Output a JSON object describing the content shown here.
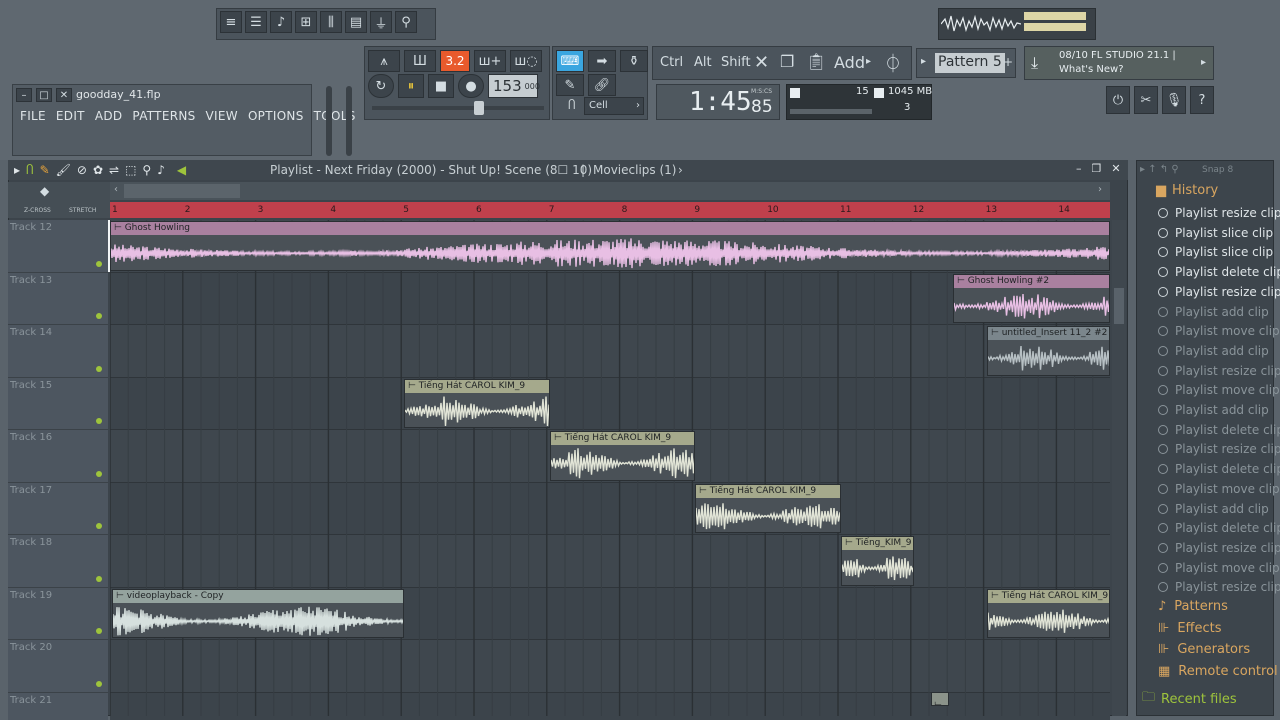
{
  "file": {
    "name": "goodday_41.flp"
  },
  "menu": [
    "FILE",
    "EDIT",
    "ADD",
    "PATTERNS",
    "VIEW",
    "OPTIONS",
    "TOOLS",
    "?"
  ],
  "transport": {
    "tempo": "153",
    "tempo_decimal": "000",
    "pattern_song": "3.2",
    "snap_mode": "Cell"
  },
  "time": {
    "display": "1:45",
    "fraction": "85",
    "unit": "M:S:CS"
  },
  "cpu": {
    "value": "15",
    "memory": "1045 MB",
    "poly": "3"
  },
  "keys": {
    "ctrl": "Ctrl",
    "alt": "Alt",
    "shift": "Shift",
    "add": "Add"
  },
  "pattern": {
    "name": "Pattern 5"
  },
  "news": {
    "line1": "08/10  FL STUDIO 21.1 |",
    "line2": "What's New?"
  },
  "playlist": {
    "title": "Playlist - Next Friday (2000) - Shut Up! Scene (8☐ 10)",
    "sep": "|",
    "movieclips": "Movieclips (1)",
    "snap": "Snap 8",
    "xcross": "Z-CROSS",
    "stretch": "STRETCH"
  },
  "ruler": [
    "1",
    "2",
    "3",
    "4",
    "5",
    "6",
    "7",
    "8",
    "9",
    "10",
    "11",
    "12",
    "13",
    "14"
  ],
  "tracks": [
    {
      "name": "Track 12"
    },
    {
      "name": "Track 13"
    },
    {
      "name": "Track 14"
    },
    {
      "name": "Track 15"
    },
    {
      "name": "Track 16"
    },
    {
      "name": "Track 17"
    },
    {
      "name": "Track 18"
    },
    {
      "name": "Track 19"
    },
    {
      "name": "Track 20"
    },
    {
      "name": "Track 21"
    }
  ],
  "clips": [
    {
      "title": "Ghost Howling",
      "color": "#c9a3c4",
      "title_color": "#a9809f",
      "wave": "#e8bfe4"
    },
    {
      "title": "Ghost Howling #2",
      "color": "#c9a3c4",
      "title_color": "#a9809f",
      "wave": "#e8bfe4"
    },
    {
      "title": "untitled_Insert 11_2 #2",
      "color": "#7f8a90",
      "title_color": "#7b868c",
      "wave": "#b7c0c4"
    },
    {
      "title": "Tiếng Hát CAROL KIM_9",
      "color": "#8b938a",
      "title_color": "#a5a98c",
      "wave": "#e1e4d6"
    },
    {
      "title": "Tiếng Hát CAROL KIM_9",
      "color": "#8b938a",
      "title_color": "#a5a98c",
      "wave": "#e1e4d6"
    },
    {
      "title": "Tiếng Hát CAROL KIM_9",
      "color": "#8b938a",
      "title_color": "#a5a98c",
      "wave": "#e1e4d6"
    },
    {
      "title": "Tiếng_KIM_9",
      "color": "#8b938a",
      "title_color": "#a5a98c",
      "wave": "#e1e4d6"
    },
    {
      "title": "videoplayback - Copy",
      "color": "#8f9a99",
      "title_color": "#94a39e",
      "wave": "#d6e0de"
    },
    {
      "title": "Tiếng Hát CAROL KIM_9",
      "color": "#8b938a",
      "title_color": "#a5a98c",
      "wave": "#e1e4d6"
    }
  ],
  "history": {
    "title": "History",
    "items": [
      "Playlist resize clip",
      "Playlist slice clip",
      "Playlist slice clip",
      "Playlist delete clip",
      "Playlist resize clip",
      "Playlist add clip",
      "Playlist move clip",
      "Playlist add clip",
      "Playlist resize clip",
      "Playlist move clip",
      "Playlist add clip",
      "Playlist delete clip",
      "Playlist resize clip",
      "Playlist delete clip",
      "Playlist move clip",
      "Playlist add clip",
      "Playlist delete clip",
      "Playlist resize clip",
      "Playlist move clip",
      "Playlist resize clip"
    ]
  },
  "browser": {
    "patterns": "Patterns",
    "effects": "Effects",
    "generators": "Generators",
    "remote": "Remote control",
    "recent": "Recent files"
  },
  "colors": {
    "ruler": "#c0404c",
    "accent_orange": "#e85a2c",
    "accent_blue": "#3aa6e0",
    "led_green": "#9ec43c"
  }
}
